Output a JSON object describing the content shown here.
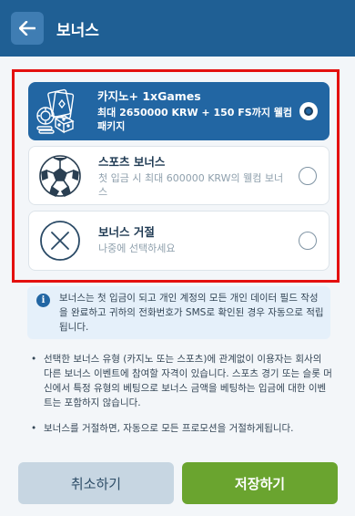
{
  "header": {
    "title": "보너스",
    "back_icon": "arrow-left-icon"
  },
  "options": [
    {
      "title": "카지노+ 1xGames",
      "description": "최대 2650000 KRW + 150 FS까지 웰컴 패키지",
      "icon": "casino-cards-dice-icon",
      "selected": true
    },
    {
      "title": "스포츠 보너스",
      "description": "첫 입금 시 최대 600000 KRW의 웰컴 보너스",
      "icon": "soccer-ball-icon",
      "selected": false
    },
    {
      "title": "보너스 거절",
      "description": "나중에 선택하세요",
      "icon": "x-circle-icon",
      "selected": false
    }
  ],
  "info": {
    "icon": "info-icon",
    "text": "보너스는 첫 입금이 되고 개인 계정의 모든 개인 데이터 필드 작성을 완료하고 귀하의 전화번호가 SMS로 확인된 경우 자동으로 적립됩니다."
  },
  "notes": [
    "선택한 보너스 유형 (카지노 또는 스포츠)에 관계없이 이용자는 회사의 다른 보너스 이벤트에 참여할 자격이 있습니다. 스포츠 경기 또는 슬롯 머신에서 특정 유형의 베팅으로 보너스 금액을 베팅하는 입금에 대한 이벤트는 포함하지 않습니다.",
    "보너스를 거절하면, 자동으로 모든 프로모션을 거절하게됩니다."
  ],
  "buttons": {
    "cancel": "취소하기",
    "save": "저장하기"
  },
  "colors": {
    "header_bg": "#1f5f94",
    "selected_option_bg": "#2266a3",
    "highlight_border": "#e4100f",
    "save_button": "#6aa42f",
    "cancel_button": "#c7d6e2"
  }
}
